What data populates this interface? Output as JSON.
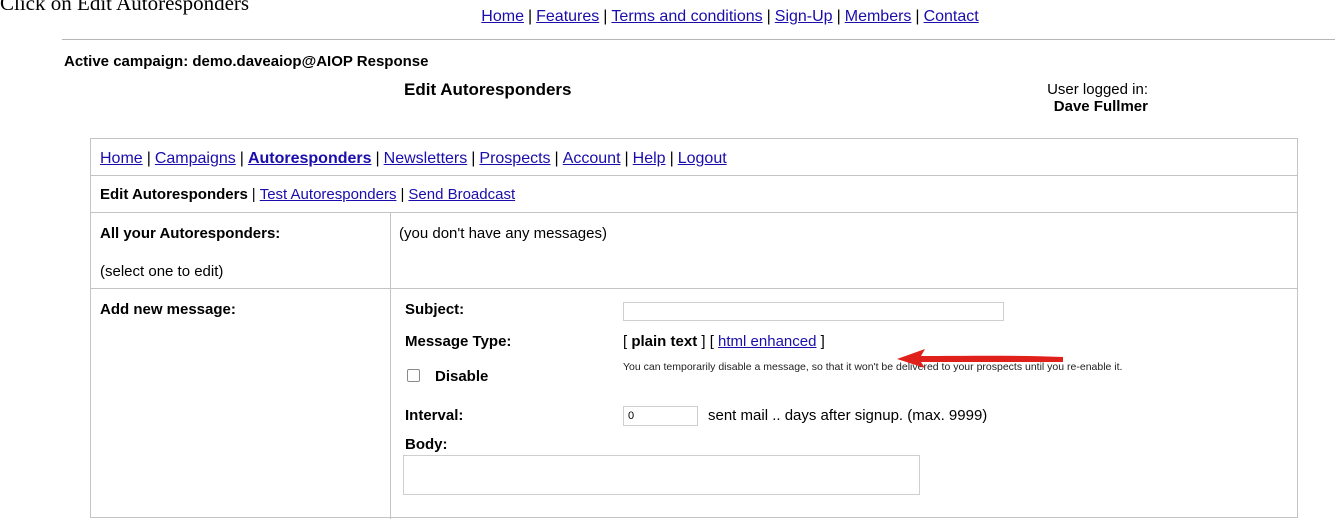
{
  "caption": "Click on Edit Autoresponders",
  "top_nav": {
    "links": [
      "Home",
      "Features",
      "Terms and conditions",
      "Sign-Up",
      "Members",
      "Contact"
    ]
  },
  "header": {
    "active_campaign": "Active campaign: demo.daveaiop@AIOP Response",
    "page_title": "Edit Autoresponders",
    "user_label": "User logged in:",
    "user_name": "Dave Fullmer"
  },
  "main_nav": {
    "items": [
      "Home",
      "Campaigns",
      "Autoresponders",
      "Newsletters",
      "Prospects",
      "Account",
      "Help",
      "Logout"
    ],
    "active": "Autoresponders"
  },
  "sub_nav": {
    "items": [
      "Edit Autoresponders",
      "Test Autoresponders",
      "Send Broadcast"
    ],
    "active": "Edit Autoresponders"
  },
  "list_section": {
    "title": "All your Autoresponders:",
    "hint": "(select one to edit)",
    "empty_message": "(you don't have any messages)"
  },
  "add_section": {
    "title": "Add new message:",
    "subject_label": "Subject:",
    "subject_value": "",
    "message_type_label": "Message Type:",
    "message_type_plain": "plain text",
    "message_type_html": "html enhanced",
    "disable_label": "Disable",
    "disable_checked": false,
    "disable_note": "You can temporarily disable a message, so that it won't be delivered to your prospects until you re-enable it.",
    "interval_label": "Interval:",
    "interval_value": "0",
    "interval_suffix": "sent mail .. days after signup. (max. 9999)",
    "body_label": "Body:"
  },
  "colors": {
    "link": "#1a0dab",
    "arrow": "#e0211b",
    "border": "#c4c4c4"
  },
  "icons": {
    "annotation": "red-arrow-icon",
    "checkbox": "checkbox-icon"
  }
}
